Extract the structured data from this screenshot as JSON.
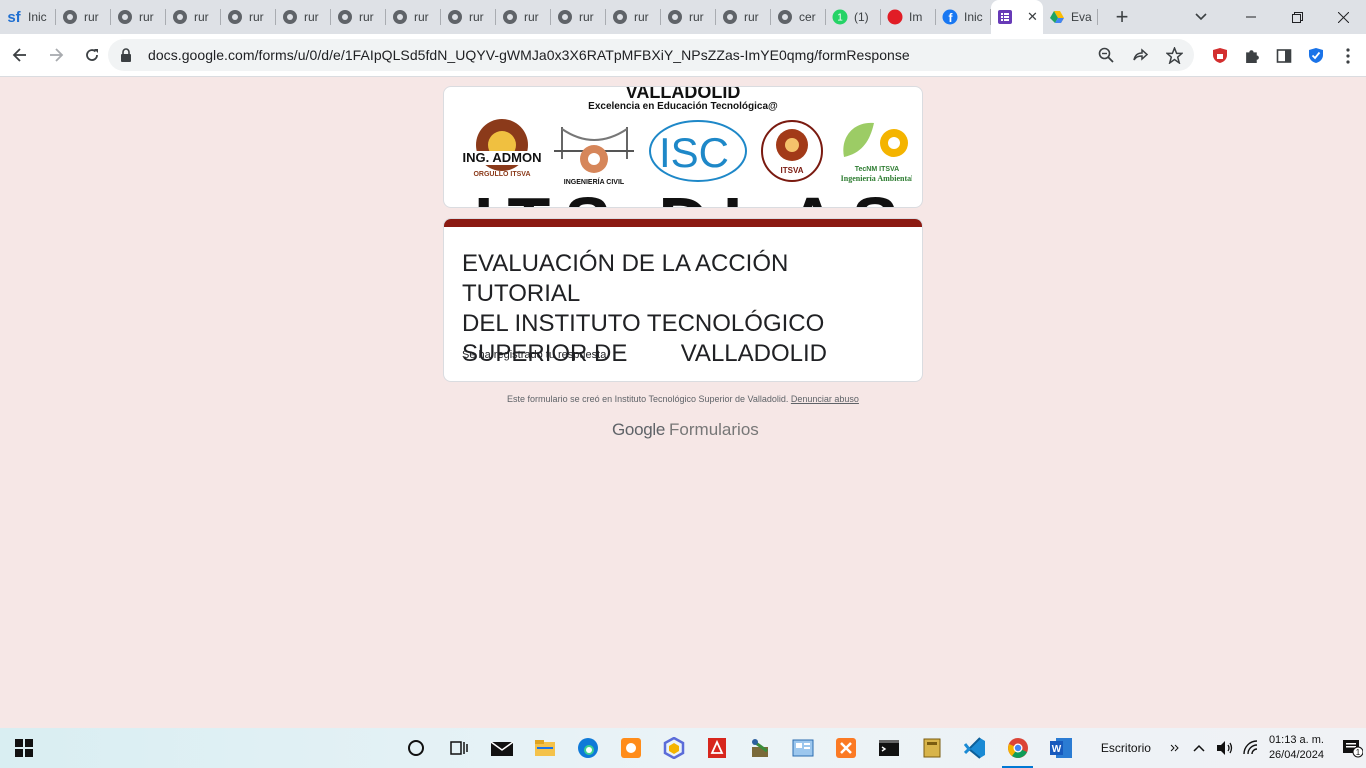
{
  "browser": {
    "tabs": [
      {
        "title": "Inic",
        "icon": "sf-icon",
        "icon_color": "#1f6fd1"
      },
      {
        "title": "rur",
        "icon": "globe-icon"
      },
      {
        "title": "rur",
        "icon": "globe-icon"
      },
      {
        "title": "rur",
        "icon": "globe-icon"
      },
      {
        "title": "rur",
        "icon": "globe-icon"
      },
      {
        "title": "rur",
        "icon": "globe-icon"
      },
      {
        "title": "rur",
        "icon": "globe-icon"
      },
      {
        "title": "rur",
        "icon": "globe-icon"
      },
      {
        "title": "rur",
        "icon": "globe-icon"
      },
      {
        "title": "rur",
        "icon": "globe-icon"
      },
      {
        "title": "rur",
        "icon": "globe-icon"
      },
      {
        "title": "rur",
        "icon": "globe-icon"
      },
      {
        "title": "rur",
        "icon": "globe-icon"
      },
      {
        "title": "rur",
        "icon": "globe-icon"
      },
      {
        "title": "cer",
        "icon": "globe-icon"
      },
      {
        "title": "(1)",
        "icon": "whatsapp-icon",
        "icon_color": "#25d366"
      },
      {
        "title": "Im",
        "icon": "red-dot-icon",
        "icon_color": "#e11d26"
      },
      {
        "title": "Inic",
        "icon": "facebook-icon",
        "icon_color": "#1877f2"
      },
      {
        "title": "",
        "icon": "forms-icon",
        "icon_color": "#673ab7",
        "active": true
      },
      {
        "title": "Eva",
        "icon": "drive-icon"
      }
    ],
    "address": "docs.google.com/forms/u/0/d/e/1FAIpQLSd5fdN_UQYV-gWMJa0x3X6RATpMFBXiY_NPsZZas-ImYE0qmg/formResponse"
  },
  "form": {
    "banner_title": "VALLADOLID",
    "banner_subtitle": "Excelencia en Educación Tecnológica@",
    "banner_big_text": "ITS DI AS",
    "logos": [
      {
        "label": "ING. ADMON",
        "sub": "ORGULLO ITSVA"
      },
      {
        "label": "INGENIERÍA CIVIL"
      },
      {
        "label": "ISC"
      },
      {
        "label": "ITSVA"
      },
      {
        "label": "TecNM ITSVA",
        "sub": "Ingeniería Ambiental"
      }
    ],
    "title": "EVALUACIÓN DE LA ACCIÓN TUTORIAL\nDEL INSTITUTO TECNOLÓGICO\nSUPERIOR DE        VALLADOLID",
    "response_message": "Se ha registrado tu respuesta.",
    "accent_color": "#8b1a12",
    "footer_text": "Este formulario se creó en Instituto Tecnológico Superior de Valladolid.",
    "report_link": "Denunciar abuso",
    "brand_google": "Google",
    "brand_forms": "Formularios"
  },
  "taskbar": {
    "desktop_label": "Escritorio",
    "time": "01:13 a. m.",
    "date": "26/04/2024",
    "notification_count": "1"
  }
}
